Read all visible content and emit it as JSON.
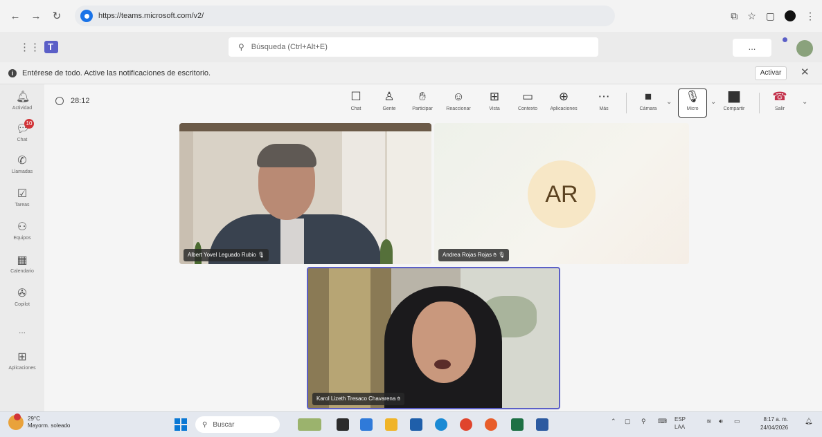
{
  "browser": {
    "url": "https://teams.microsoft.com/v2/"
  },
  "teams_header": {
    "search_placeholder": "Búsqueda (Ctrl+Alt+E)",
    "more_label": "..."
  },
  "banner": {
    "text": "Entérese de todo. Active las notificaciones de escritorio.",
    "activate_label": "Activar"
  },
  "rail": {
    "items": [
      {
        "label": "Actividad",
        "icon": "bell-icon"
      },
      {
        "label": "Chat",
        "icon": "chat-icon",
        "badge": "10"
      },
      {
        "label": "Llamadas",
        "icon": "phone-icon"
      },
      {
        "label": "Tareas",
        "icon": "tasks-icon"
      },
      {
        "label": "Equipos",
        "icon": "teams-icon"
      },
      {
        "label": "Calendario",
        "icon": "calendar-icon"
      },
      {
        "label": "Copilot",
        "icon": "copilot-icon"
      },
      {
        "label": "...",
        "icon": "more-icon"
      },
      {
        "label": "Aplicaciones",
        "icon": "apps-icon"
      }
    ]
  },
  "meeting": {
    "timer": "28:12",
    "tools": [
      {
        "label": "Chat",
        "icon": "chat-icon"
      },
      {
        "label": "Gente",
        "icon": "people-icon"
      },
      {
        "label": "Participar",
        "icon": "raise-hand-icon"
      },
      {
        "label": "Reaccionar",
        "icon": "react-icon"
      },
      {
        "label": "Vista",
        "icon": "view-icon"
      },
      {
        "label": "Contexto",
        "icon": "notes-icon"
      },
      {
        "label": "Aplicaciones",
        "icon": "apps-icon"
      },
      {
        "label": "Más",
        "icon": "more-icon"
      }
    ],
    "camera_label": "Cámara",
    "mic_label": "Micro",
    "share_label": "Compartir",
    "leave_label": "Salir"
  },
  "participants": [
    {
      "name": "Albert Yovel Leguado Rubio"
    },
    {
      "name": "Andrea Rojas Rojas",
      "initials": "AR"
    },
    {
      "name": "Karol Lizeth Tresaco Chavarena"
    }
  ],
  "taskbar": {
    "weather_temp": "29°C",
    "weather_text": "Mayorm. soleado",
    "search_placeholder": "Buscar",
    "lang": "ESP",
    "lang_sub": "LAA",
    "time": "8:17 a. m.",
    "date": "24/04/2026"
  }
}
